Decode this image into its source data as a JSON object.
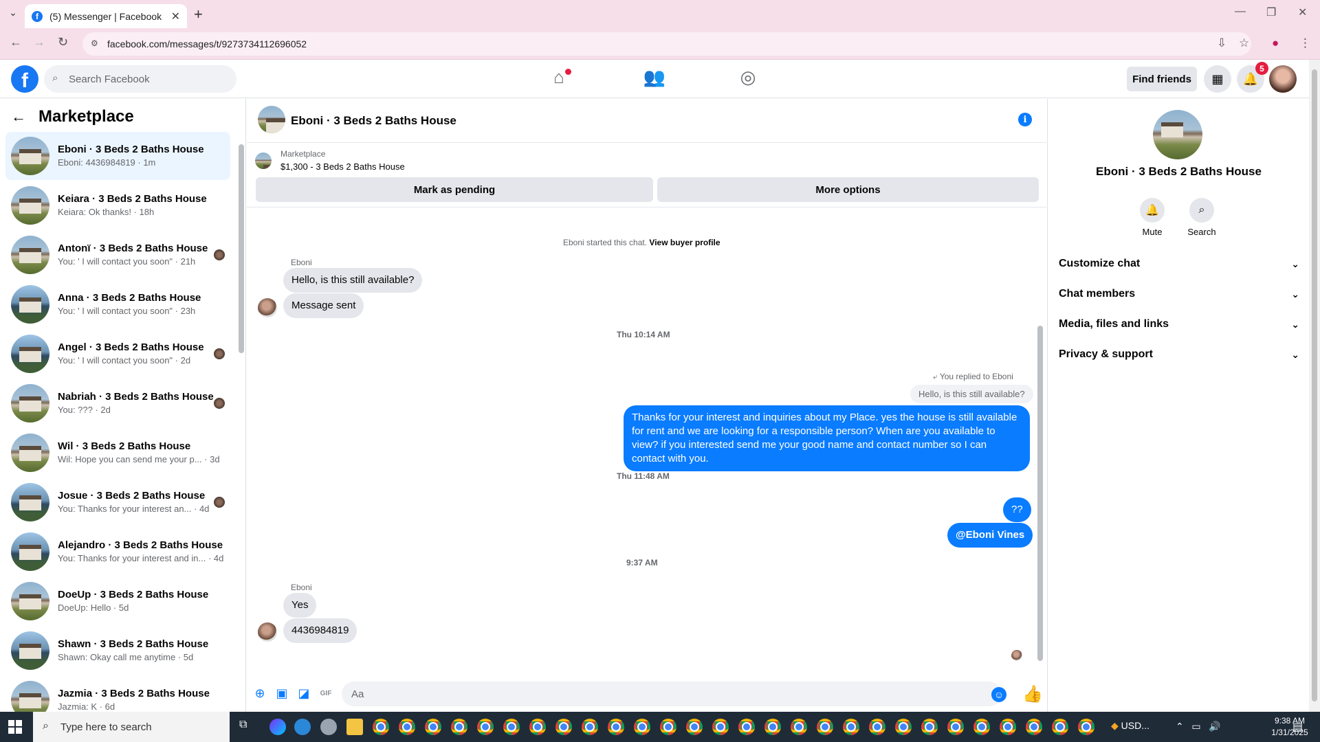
{
  "browser": {
    "tab_title": "(5) Messenger | Facebook",
    "url": "facebook.com/messages/t/9273734112696052"
  },
  "fb": {
    "search_placeholder": "Search Facebook",
    "find_friends": "Find friends",
    "notification_count": "5"
  },
  "sidebar": {
    "title": "Marketplace",
    "conversations": [
      {
        "title": "Eboni · 3 Beds 2 Baths House",
        "sub": "Eboni: 4436984819 · 1m",
        "active": true
      },
      {
        "title": "Keiara · 3 Beds 2 Baths House",
        "sub": "Keiara: Ok thanks! · 18h"
      },
      {
        "title": "Antonï · 3 Beds 2 Baths House",
        "sub": "You: ' I will contact you soon\" · 21h"
      },
      {
        "title": "Anna · 3 Beds 2 Baths House",
        "sub": "You: ' I will contact you soon\" · 23h"
      },
      {
        "title": "Angel · 3 Beds 2 Baths House",
        "sub": "You: ' I will contact you soon\" · 2d"
      },
      {
        "title": "Nabriah · 3 Beds 2 Baths House",
        "sub": "You: ??? · 2d"
      },
      {
        "title": "Wil · 3 Beds 2 Baths House",
        "sub": "Wil: Hope you can send me your p... · 3d"
      },
      {
        "title": "Josue · 3 Beds 2 Baths House",
        "sub": "You: Thanks for your interest an... · 4d"
      },
      {
        "title": "Alejandro · 3 Beds 2 Baths House",
        "sub": "You: Thanks for your interest and in... · 4d"
      },
      {
        "title": "DoeUp · 3 Beds 2 Baths House",
        "sub": "DoeUp: Hello · 5d"
      },
      {
        "title": "Shawn · 3 Beds 2 Baths House",
        "sub": "Shawn: Okay call me anytime · 5d"
      },
      {
        "title": "Jazmia · 3 Beds 2 Baths House",
        "sub": "Jazmia: K · 6d"
      }
    ]
  },
  "chat": {
    "title": "Eboni · 3 Beds 2 Baths House",
    "marketplace_label": "Marketplace",
    "listing": "$1,300 - 3 Beds 2 Baths House",
    "mark_pending": "Mark as pending",
    "more_options": "More options",
    "started_text": "Eboni started this chat.",
    "view_profile": "View buyer profile",
    "sender_name": "Eboni",
    "msg_1": "Hello, is this still available?",
    "msg_2": "Message sent",
    "time_1": "Thu 10:14 AM",
    "replied_to": "You replied to Eboni",
    "reply_quote": "Hello, is this still available?",
    "msg_3": "Thanks for your interest and inquiries about my Place. yes the house is still available for rent and we are looking for a responsible person? When are you available to view? if you interested send me your good name and contact number  so I can contact with you.",
    "time_2": "Thu 11:48 AM",
    "msg_4": "??",
    "msg_5": "@Eboni Vines",
    "time_3": "9:37 AM",
    "msg_6": "Yes",
    "msg_7": "4436984819",
    "input_placeholder": "Aa"
  },
  "info_panel": {
    "name": "Eboni · 3 Beds 2 Baths House",
    "mute": "Mute",
    "search": "Search",
    "rows": [
      "Customize chat",
      "Chat members",
      "Media, files and links",
      "Privacy & support"
    ]
  },
  "taskbar": {
    "search_placeholder": "Type here to search",
    "weather": "USD...",
    "time": "9:38 AM",
    "date": "1/31/2025"
  }
}
